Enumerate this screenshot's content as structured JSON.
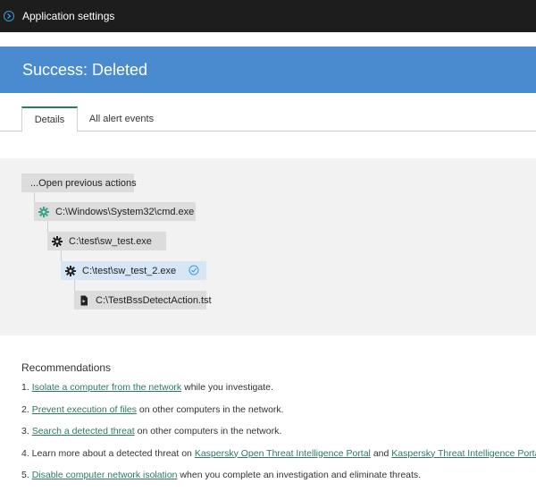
{
  "window": {
    "title": "Application settings"
  },
  "banner": {
    "title": "Success: Deleted"
  },
  "tabs": [
    {
      "label": "Details",
      "active": true
    },
    {
      "label": "All alert events",
      "active": false
    }
  ],
  "tree": {
    "open_previous_label": "...Open previous actions",
    "nodes": [
      {
        "label": "C:\\Windows\\System32\\cmd.exe",
        "icon": "gear-icon",
        "icon_color": "#3aa58a"
      },
      {
        "label": "C:\\test\\sw_test.exe",
        "icon": "gear-icon",
        "icon_color": "#222222"
      },
      {
        "label": "C:\\test\\sw_test_2.exe",
        "icon": "gear-icon",
        "icon_color": "#222222",
        "selected": true,
        "status_icon": "check-circle-icon"
      },
      {
        "label": "C:\\TestBssDetectAction.tst",
        "icon": "file-icon",
        "icon_color": "#222222"
      }
    ]
  },
  "recommendations": {
    "heading": "Recommendations",
    "items": [
      {
        "prefix": "1. ",
        "link": "Isolate a computer from the network",
        "suffix": " while you investigate."
      },
      {
        "prefix": "2. ",
        "link": "Prevent execution of files",
        "suffix": " on other computers in the network."
      },
      {
        "prefix": "3. ",
        "link": "Search a detected threat",
        "suffix": " on other computers in the network."
      },
      {
        "prefix": "4. Learn more about a detected threat on ",
        "link": "Kaspersky Open Threat Intelligence Portal",
        "middle": " and ",
        "link2": "Kaspersky Threat Intelligence Portal",
        "suffix": "."
      },
      {
        "prefix": "5. ",
        "link": "Disable computer network isolation",
        "suffix": " when you complete an investigation and eliminate threats."
      }
    ]
  },
  "colors": {
    "accent_green": "#2c7a5d",
    "banner_blue": "#4a8bd0",
    "topbar": "#1d1d1d"
  }
}
